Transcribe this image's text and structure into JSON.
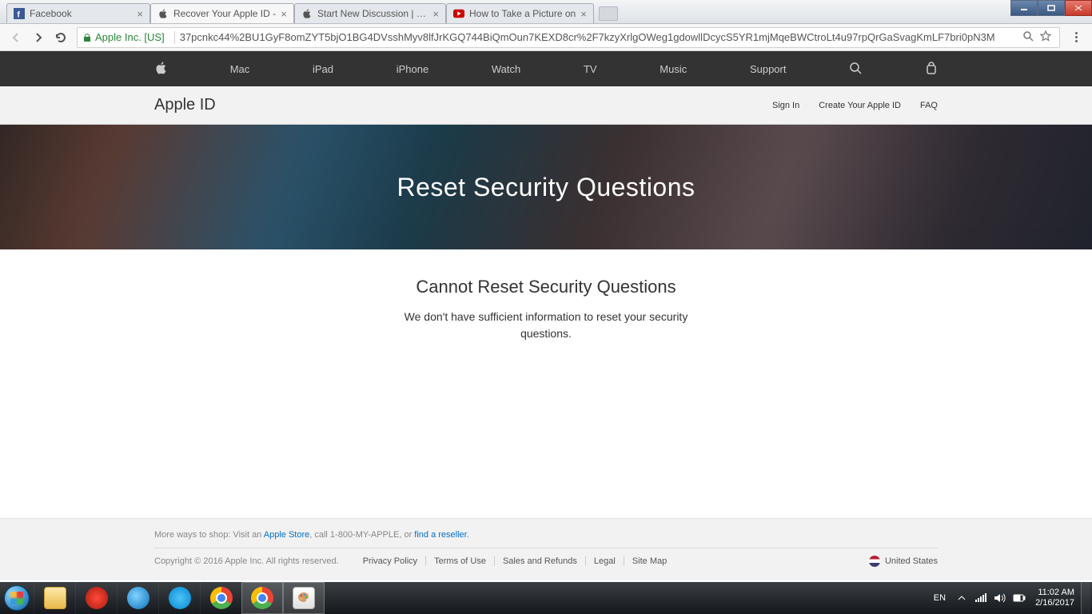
{
  "tabs": [
    {
      "title": "Facebook",
      "favicon": "facebook"
    },
    {
      "title": "Recover Your Apple ID - ",
      "favicon": "apple",
      "active": true
    },
    {
      "title": "Start New Discussion | Co",
      "favicon": "apple"
    },
    {
      "title": "How to Take a Picture on",
      "favicon": "youtube"
    }
  ],
  "address": {
    "secure_label": "Apple Inc. [US]",
    "url": "37pcnkc44%2BU1GyF8omZYT5bjO1BG4DVsshMyv8lfJrKGQ744BiQmOun7KEXD8cr%2F7kzyXrlgOWeg1gdowllDcycS5YR1mjMqeBWCtroLt4u97rpQrGaSvagKmLF7bri0pN3M"
  },
  "apple_nav": [
    "Mac",
    "iPad",
    "iPhone",
    "Watch",
    "TV",
    "Music",
    "Support"
  ],
  "sub_nav": {
    "brand": "Apple ID",
    "links": [
      "Sign In",
      "Create Your Apple ID",
      "FAQ"
    ]
  },
  "hero": {
    "title": "Reset Security Questions"
  },
  "main": {
    "heading": "Cannot Reset Security Questions",
    "body": "We don't have sufficient information to reset your security questions."
  },
  "footer": {
    "shop_prefix": "More ways to shop: Visit an ",
    "shop_link1": "Apple Store",
    "shop_mid": ", call 1-800-MY-APPLE, or ",
    "shop_link2": "find a reseller",
    "shop_suffix": ".",
    "copyright": "Copyright © 2016 Apple Inc. All rights reserved.",
    "links": [
      "Privacy Policy",
      "Terms of Use",
      "Sales and Refunds",
      "Legal",
      "Site Map"
    ],
    "country": "United States"
  },
  "tray": {
    "lang": "EN",
    "time": "11:02 AM",
    "date": "2/16/2017"
  }
}
